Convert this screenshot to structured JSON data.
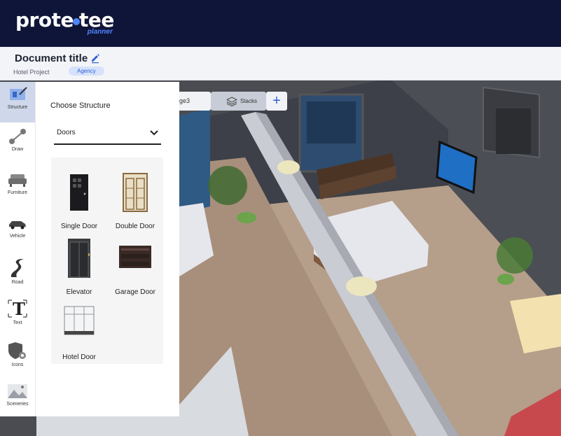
{
  "app": {
    "logo_text_left": "prote",
    "logo_text_right": "tee",
    "logo_sub": "planner",
    "brand_color": "#0f1538",
    "accent": "#2f5fd8"
  },
  "document": {
    "title": "Document title",
    "project": "Hotel Project",
    "badge": "Agency"
  },
  "toolbar": {
    "items": [
      {
        "label": "Structure",
        "icon": "structure-icon"
      },
      {
        "label": "Draw",
        "icon": "draw-icon"
      },
      {
        "label": "Furniture",
        "icon": "sofa-icon"
      },
      {
        "label": "Vehicle",
        "icon": "car-icon"
      },
      {
        "label": "Road",
        "icon": "road-icon"
      },
      {
        "label": "Text",
        "icon": "text-icon"
      },
      {
        "label": "Icons",
        "icon": "shield-gear-icon"
      },
      {
        "label": "Sceneries",
        "icon": "scenery-icon"
      }
    ]
  },
  "panel": {
    "title": "Choose Structure",
    "dropdown_value": "Doors",
    "items": [
      {
        "label": "Single Door"
      },
      {
        "label": "Double Door"
      },
      {
        "label": "Elevator"
      },
      {
        "label": "Garage Door"
      },
      {
        "label": "Hotel Door"
      }
    ]
  },
  "tabs": {
    "partial_tab": "ge3",
    "stacks": "Stacks",
    "add": "+"
  }
}
